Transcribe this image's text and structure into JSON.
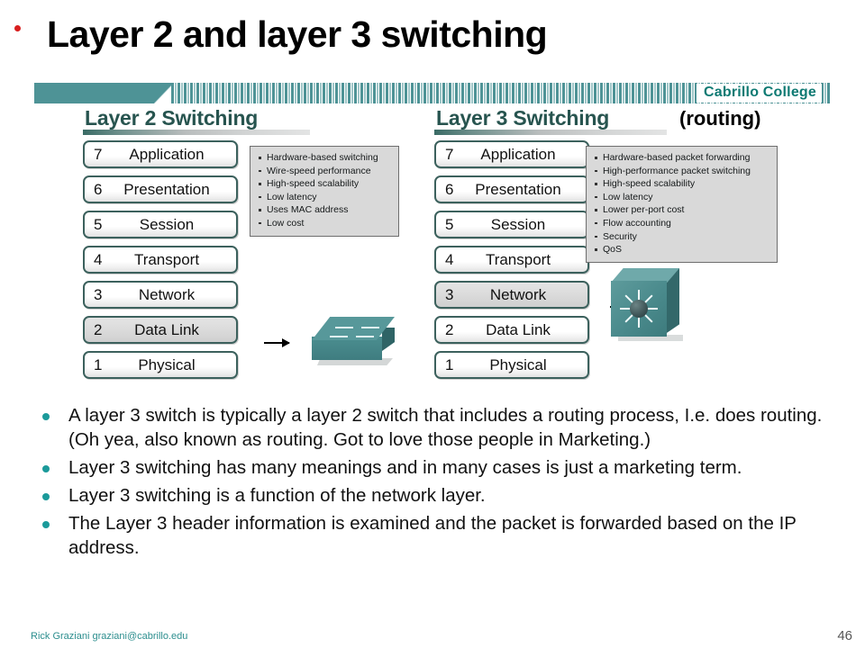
{
  "slide": {
    "title": "Layer 2 and layer 3 switching",
    "page_number": "46",
    "accent_teal": "#4e9396",
    "heading_color": "#27544f",
    "bullet_color": "#1b9a9a"
  },
  "banner": {
    "institution": "Cabrillo College"
  },
  "left_panel": {
    "heading": "Layer 2 Switching",
    "layers": [
      {
        "num": "7",
        "name": "Application",
        "highlighted": false
      },
      {
        "num": "6",
        "name": "Presentation",
        "highlighted": false
      },
      {
        "num": "5",
        "name": "Session",
        "highlighted": false
      },
      {
        "num": "4",
        "name": "Transport",
        "highlighted": false
      },
      {
        "num": "3",
        "name": "Network",
        "highlighted": false
      },
      {
        "num": "2",
        "name": "Data Link",
        "highlighted": true
      },
      {
        "num": "1",
        "name": "Physical",
        "highlighted": false
      }
    ],
    "features": [
      "Hardware-based switching",
      "Wire-speed performance",
      "High-speed scalability",
      "Low latency",
      "Uses MAC address",
      "Low cost"
    ],
    "device_icon": "switch-icon"
  },
  "right_panel": {
    "heading": "Layer 3 Switching",
    "heading_note": "(routing)",
    "layers": [
      {
        "num": "7",
        "name": "Application",
        "highlighted": false
      },
      {
        "num": "6",
        "name": "Presentation",
        "highlighted": false
      },
      {
        "num": "5",
        "name": "Session",
        "highlighted": false
      },
      {
        "num": "4",
        "name": "Transport",
        "highlighted": false
      },
      {
        "num": "3",
        "name": "Network",
        "highlighted": true
      },
      {
        "num": "2",
        "name": "Data Link",
        "highlighted": false
      },
      {
        "num": "1",
        "name": "Physical",
        "highlighted": false
      }
    ],
    "features": [
      "Hardware-based packet forwarding",
      "High-performance packet switching",
      "High-speed scalability",
      "Low latency",
      "Lower per-port cost",
      "Flow accounting",
      "Security",
      "QoS"
    ],
    "device_icon": "multilayer-switch-icon"
  },
  "body_bullets": [
    "A layer 3 switch is typically a layer 2 switch that includes a routing process, I.e. does routing.  (Oh yea, also known as routing.  Got to love those people in Marketing.)",
    "Layer 3 switching has many meanings and in many cases is just a marketing term.",
    "Layer 3 switching is a function of the network layer.",
    "The Layer 3 header information is examined and the packet is forwarded based on the IP address."
  ],
  "footer": {
    "author_contact": "Rick Graziani  graziani@cabrillo.edu"
  }
}
